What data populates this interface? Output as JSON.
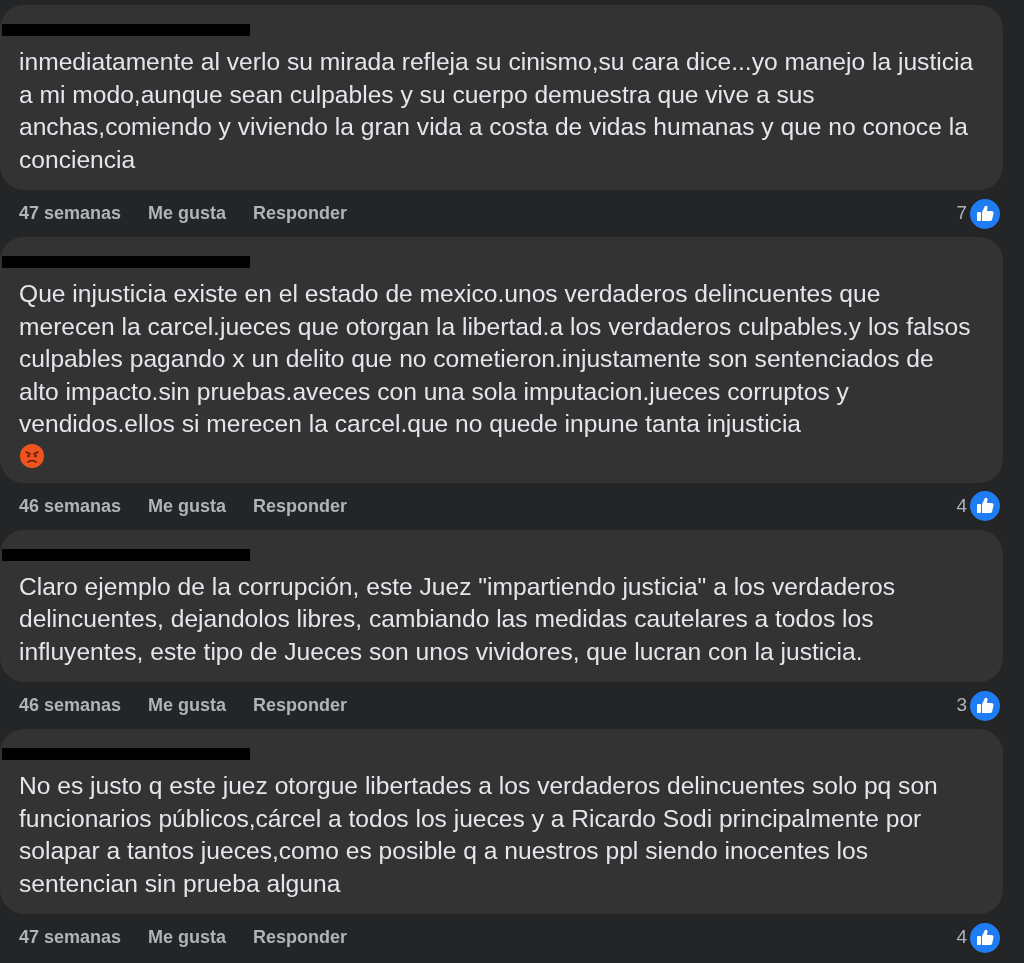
{
  "comments": [
    {
      "text": "inmediatamente al verlo su mirada refleja su cinismo,su cara dice...yo manejo la justicia a mi modo,aunque sean culpables y su cuerpo demuestra que vive a sus anchas,comiendo y viviendo la gran vida a costa de vidas humanas y que no conoce la conciencia",
      "time": "47 semanas",
      "like": "Me gusta",
      "reply": "Responder",
      "likes": "7"
    },
    {
      "text": "Que injusticia existe en el estado de mexico.unos verdaderos delincuentes que merecen la carcel.jueces que otorgan la libertad.a los verdaderos culpables.y los falsos culpables pagando x un delito que no cometieron.injustamente son sentenciados de alto impacto.sin pruebas.aveces con una sola imputacion.jueces corruptos y vendidos.ellos si merecen la carcel.que no quede inpune tanta injusticia",
      "angry_emoji": true,
      "time": "46 semanas",
      "like": "Me gusta",
      "reply": "Responder",
      "likes": "4"
    },
    {
      "text": "Claro ejemplo de la corrupción, este Juez \"impartiendo justicia\" a los verdaderos delincuentes, dejandolos libres, cambiando las medidas cautelares a todos los influyentes, este tipo de Jueces son unos vividores, que lucran con la justicia.",
      "time": "46 semanas",
      "like": "Me gusta",
      "reply": "Responder",
      "likes": "3"
    },
    {
      "text": "No es justo q este juez otorgue libertades a los verdaderos delincuentes solo pq son funcionarios públicos,cárcel a todos los jueces y a Ricardo Sodi principalmente por solapar a tantos jueces,como es posible q a nuestros ppl siendo inocentes los sentencian sin prueba alguna",
      "time": "47 semanas",
      "like": "Me gusta",
      "reply": "Responder",
      "likes": "4"
    }
  ]
}
